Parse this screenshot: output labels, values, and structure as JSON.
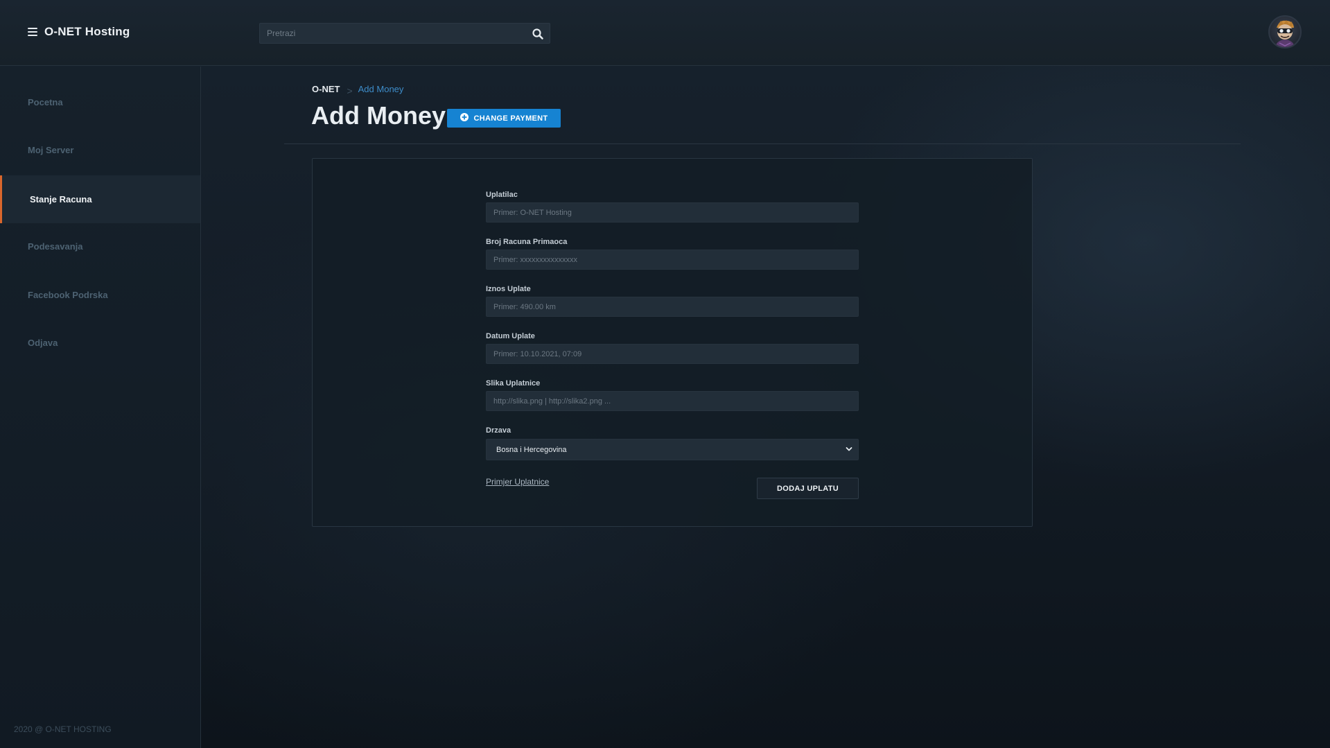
{
  "header": {
    "brand": "O-NET Hosting",
    "search_placeholder": "Pretrazi",
    "search_value": ""
  },
  "sidebar": {
    "items": [
      {
        "label": "Pocetna",
        "active": false
      },
      {
        "label": "Moj Server",
        "active": false
      },
      {
        "label": "Stanje Racuna",
        "active": true
      },
      {
        "label": "Podesavanja",
        "active": false
      },
      {
        "label": "Facebook Podrska",
        "active": false
      },
      {
        "label": "Odjava",
        "active": false
      }
    ],
    "footer": "2020 @ O-NET HOSTING"
  },
  "breadcrumb": {
    "root": "O-NET",
    "separator": ">",
    "current": "Add Money"
  },
  "page": {
    "title": "Add Money",
    "change_payment_label": "CHANGE PAYMENT"
  },
  "form": {
    "fields": [
      {
        "label": "Uplatilac",
        "placeholder": "Primer: O-NET Hosting",
        "value": ""
      },
      {
        "label": "Broj Racuna Primaoca",
        "placeholder": "Primer: xxxxxxxxxxxxxxx",
        "value": ""
      },
      {
        "label": "Iznos Uplate",
        "placeholder": "Primer: 490.00 km",
        "value": ""
      },
      {
        "label": "Datum Uplate",
        "placeholder": "Primer: 10.10.2021, 07:09",
        "value": ""
      },
      {
        "label": "Slika Uplatnice",
        "placeholder": "http://slika.png | http://slika2.png ...",
        "value": ""
      }
    ],
    "country": {
      "label": "Drzava",
      "selected": "Bosna i Hercegovina"
    },
    "example_link": "Primjer Uplatnice",
    "submit_label": "DODAJ UPLATU"
  },
  "colors": {
    "accent_blue": "#1683d2",
    "active_marker": "#d9662c",
    "link_blue": "#3d8cc9"
  }
}
